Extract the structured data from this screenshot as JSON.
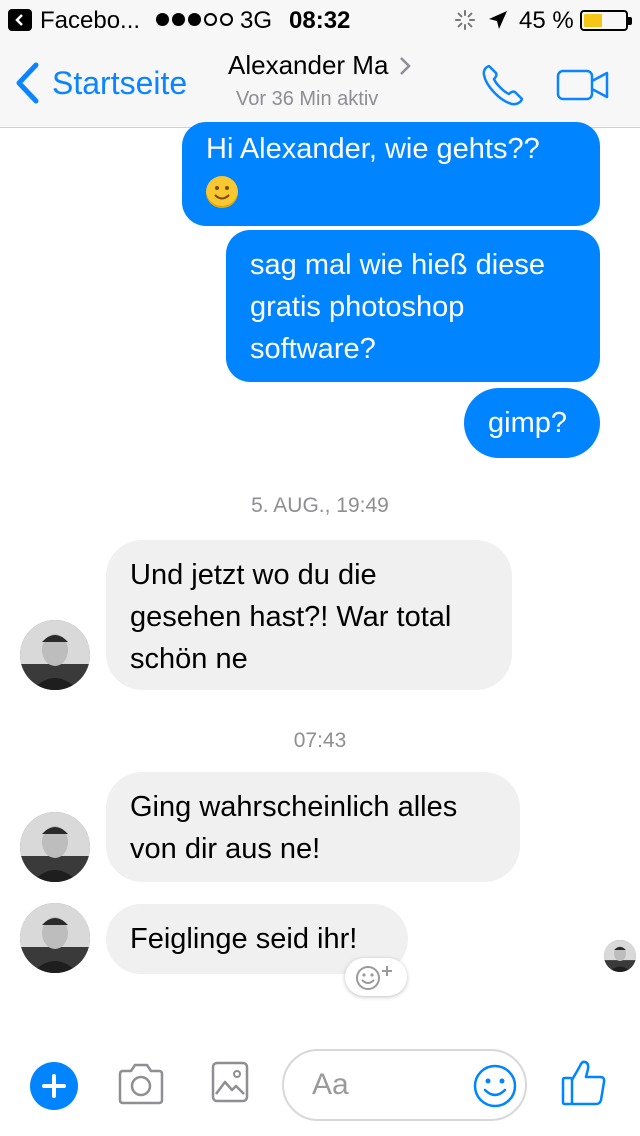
{
  "status_bar": {
    "app_name": "Facebo...",
    "network": "3G",
    "time": "08:32",
    "battery_percent": "45 %",
    "battery_level": 0.45
  },
  "nav": {
    "back_label": "Startseite",
    "contact_name": "Alexander Ma",
    "active_status": "Vor 36 Min aktiv"
  },
  "messages": {
    "m1": {
      "lines": [
        "Hi Alexander, wie gehts??"
      ]
    },
    "m2": {
      "lines": [
        "sag mal wie hieß diese",
        "gratis photoshop",
        "software?"
      ]
    },
    "m3": {
      "lines": [
        "gimp?"
      ]
    },
    "ts1": "5. AUG., 19:49",
    "m4": {
      "lines": [
        "Und jetzt wo du die",
        "gesehen hast?! War total",
        "schön ne"
      ]
    },
    "ts2": "07:43",
    "m5": {
      "lines": [
        "Ging wahrscheinlich alles",
        "von dir aus ne!"
      ]
    },
    "m6": {
      "lines": [
        "Feiglinge seid ihr!"
      ]
    }
  },
  "composer": {
    "placeholder": "Aa"
  },
  "colors": {
    "accent": "#0084ff",
    "incoming_bubble": "#f1f0f0",
    "battery": "#f5c518"
  },
  "icons": [
    "back-chevron-icon",
    "phone-icon",
    "video-camera-icon",
    "plus-icon",
    "camera-icon",
    "image-icon",
    "smiley-icon",
    "thumbs-up-icon",
    "add-reaction-icon"
  ]
}
